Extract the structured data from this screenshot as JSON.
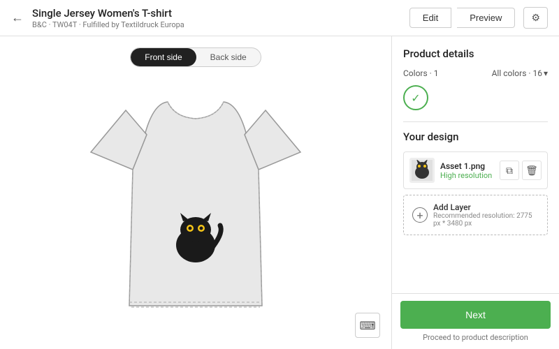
{
  "header": {
    "back_icon": "←",
    "title": "Single Jersey Women's T-shirt",
    "subtitle": "B&C · TW04T · Fulfilled by Textildruck Europa",
    "edit_label": "Edit",
    "preview_label": "Preview",
    "settings_icon": "⚙"
  },
  "side_toggle": {
    "front_label": "Front side",
    "back_label": "Back side"
  },
  "right_panel": {
    "product_details_title": "Product details",
    "colors_label": "Colors · 1",
    "all_colors_label": "All colors · 16",
    "your_design_title": "Your design",
    "design_item": {
      "name": "Asset 1.png",
      "resolution": "High resolution"
    },
    "add_layer": {
      "label": "Add Layer",
      "sublabel": "Recommended resolution: 2775 px * 3480 px"
    },
    "next_button": "Next",
    "footer_hint": "Proceed to product description"
  }
}
